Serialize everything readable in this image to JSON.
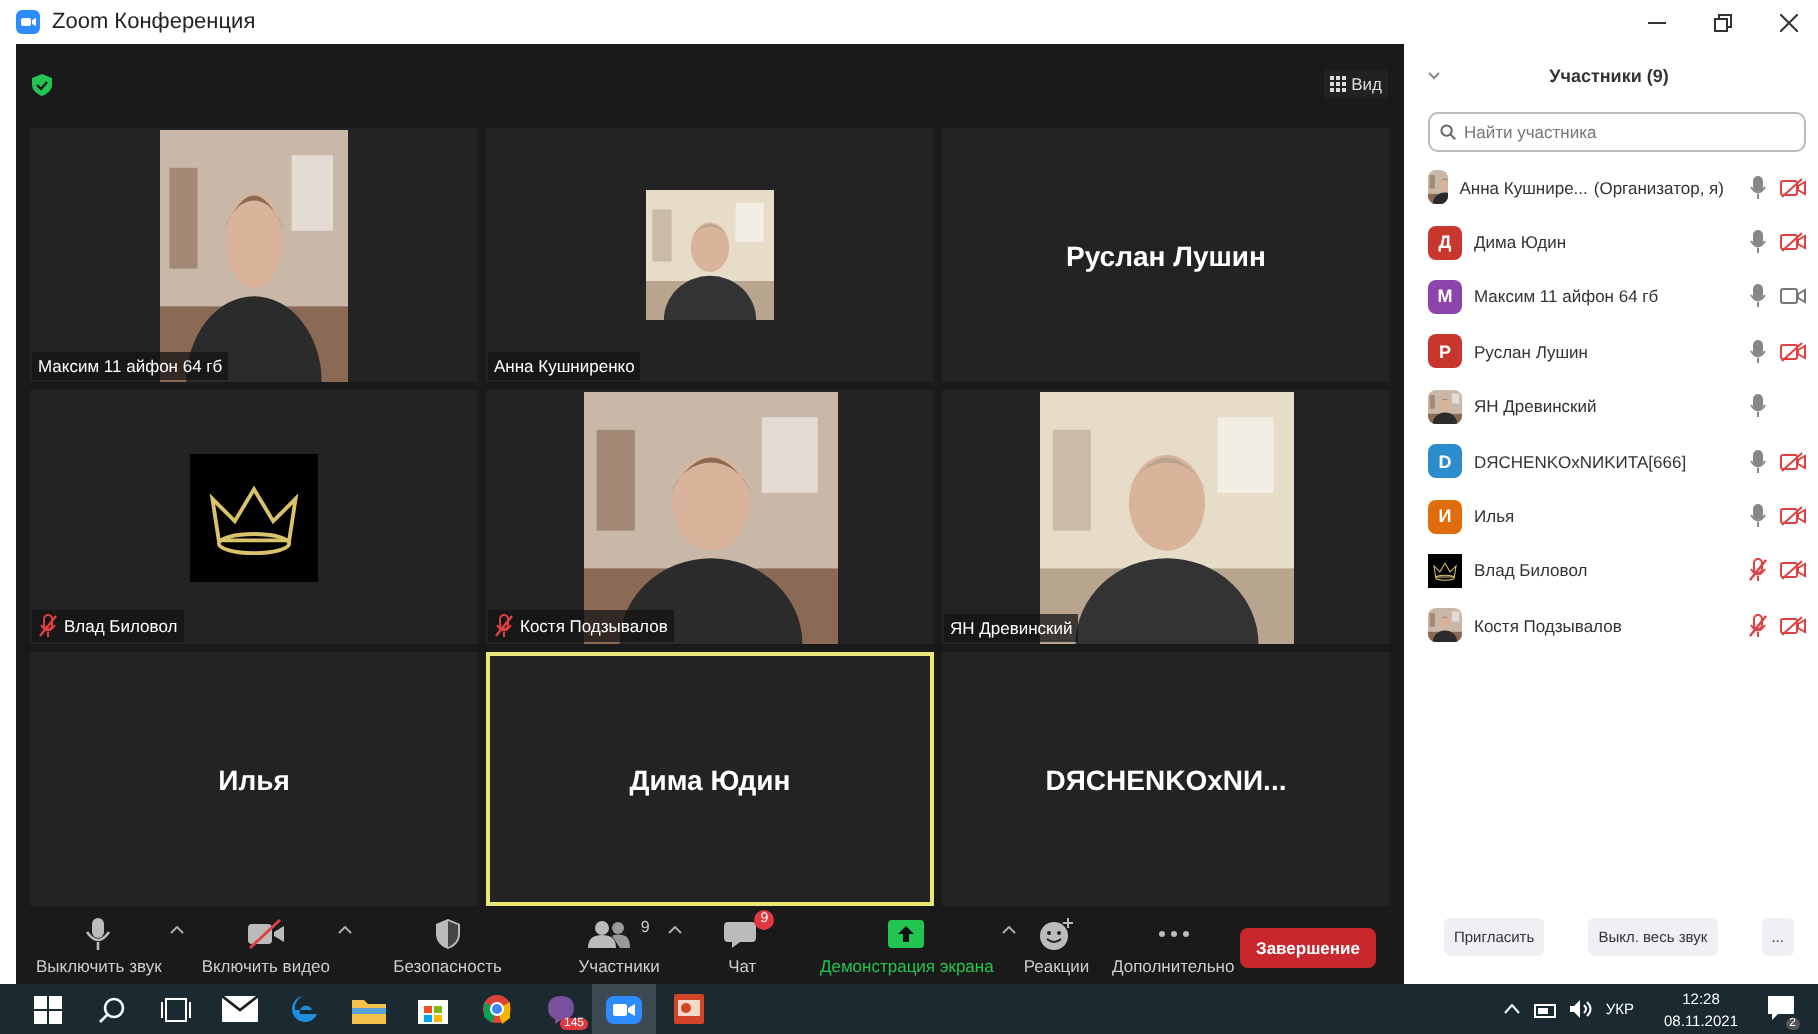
{
  "window": {
    "title": "Zoom Конференция"
  },
  "top_bar": {
    "view_label": "Вид"
  },
  "tiles": [
    {
      "name": "Максим 11 айфон 64 гб",
      "kind": "video",
      "muted": false,
      "highlighted": false
    },
    {
      "name": "Анна Кушниренко",
      "kind": "video_small",
      "muted": false,
      "highlighted": false
    },
    {
      "name": "Руслан Лушин",
      "kind": "name",
      "highlighted": false
    },
    {
      "name": "Влад Биловол",
      "kind": "crown",
      "muted": true,
      "highlighted": false
    },
    {
      "name": "Костя Подзывалов",
      "kind": "video",
      "muted": true,
      "highlighted": false
    },
    {
      "name": "ЯН Древинский",
      "kind": "video",
      "muted": false,
      "highlighted": false
    },
    {
      "name": "Илья",
      "kind": "name",
      "highlighted": false
    },
    {
      "name": "Дима Юдин",
      "kind": "name",
      "highlighted": true
    },
    {
      "name": "DЯCHENKOxNИ...",
      "kind": "name",
      "highlighted": false
    }
  ],
  "toolbar": [
    {
      "kind": "mic",
      "label": "Выключить звук",
      "caret": true
    },
    {
      "kind": "video_off",
      "label": "Включить видео",
      "caret": true
    },
    {
      "kind": "shield",
      "label": "Безопасность",
      "caret": false
    },
    {
      "kind": "people",
      "label": "Участники",
      "count": "9",
      "caret": true
    },
    {
      "kind": "chat",
      "label": "Чат",
      "badge": "9",
      "caret": false
    },
    {
      "kind": "share",
      "label": "Демонстрация экрана",
      "caret": true
    },
    {
      "kind": "reaction",
      "label": "Реакции",
      "caret": false
    },
    {
      "kind": "more",
      "label": "Дополнительно",
      "caret": false
    }
  ],
  "end_button": "Завершение",
  "participants": {
    "title": "Участники (9)",
    "search": {
      "placeholder": "Найти участника"
    },
    "items": [
      {
        "name": "Анна Кушнире...",
        "role": "(Организатор, я)",
        "mic_muted": false,
        "video_off": true
      },
      {
        "name": "Дима Юдин",
        "kind": "letter",
        "letter": "Д",
        "color": "#c8372d",
        "mic_muted": false,
        "video_off": true
      },
      {
        "name": "Максим 11 айфон 64 гб",
        "kind": "letter",
        "letter": "М",
        "color": "#8e44ad",
        "mic_muted": false,
        "video_off": false
      },
      {
        "name": "Руслан Лушин",
        "kind": "letter",
        "letter": "Р",
        "color": "#c8372d",
        "mic_muted": false,
        "video_off": true
      },
      {
        "name": "ЯН Древинский",
        "mic_muted": false
      },
      {
        "name": "DЯCHENKOxNИKИTA[666]",
        "kind": "letter",
        "letter": "D",
        "color": "#2d8cce",
        "mic_muted": false,
        "video_off": true
      },
      {
        "name": "Илья",
        "kind": "letter",
        "letter": "И",
        "color": "#e06c0b",
        "mic_muted": false,
        "video_off": true
      },
      {
        "name": "Влад Биловол",
        "kind": "crown",
        "mic_muted": true,
        "video_off": true
      },
      {
        "name": "Костя Подзывалов",
        "mic_muted": true,
        "video_off": true
      }
    ],
    "buttons": [
      "Пригласить",
      "Выкл. весь звук",
      "..."
    ]
  },
  "taskbar": {
    "apps": [
      {
        "kind": "start"
      },
      {
        "kind": "search"
      },
      {
        "kind": "taskview"
      },
      {
        "kind": "mail"
      },
      {
        "kind": "edge"
      },
      {
        "kind": "folder"
      },
      {
        "kind": "store"
      },
      {
        "kind": "chrome"
      },
      {
        "kind": "viber",
        "badge": "145"
      },
      {
        "kind": "zoom",
        "selected": true
      },
      {
        "kind": "slides"
      }
    ],
    "language": "УКР",
    "time": "12:28",
    "date": "08.11.2021",
    "notifications": "2"
  }
}
